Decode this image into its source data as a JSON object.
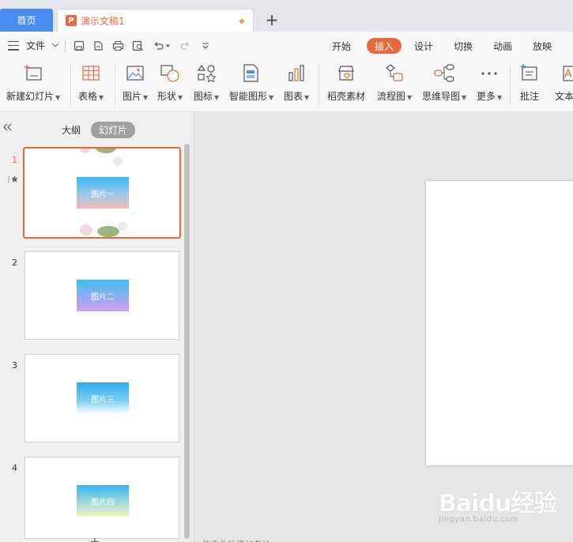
{
  "tabs": {
    "home": "首页",
    "doc_icon": "P",
    "doc_title": "演示文稿1",
    "add": "+"
  },
  "menu": {
    "file": "文件",
    "tabs": [
      "开始",
      "插入",
      "设计",
      "切换",
      "动画",
      "放映"
    ],
    "active_tab": "插入"
  },
  "ribbon": [
    {
      "label": "新建幻灯片",
      "caret": true,
      "icon": "new-slide-icon"
    },
    {
      "label": "表格",
      "caret": true,
      "icon": "table-icon"
    },
    {
      "label": "图片",
      "caret": true,
      "icon": "picture-icon"
    },
    {
      "label": "形状",
      "caret": true,
      "icon": "shapes-icon"
    },
    {
      "label": "图标",
      "caret": true,
      "icon": "icons-icon"
    },
    {
      "label": "智能图形",
      "caret": true,
      "icon": "smartart-icon"
    },
    {
      "label": "图表",
      "caret": true,
      "icon": "chart-icon"
    },
    {
      "label": "稻壳素材",
      "caret": false,
      "icon": "docer-material-icon"
    },
    {
      "label": "流程图",
      "caret": true,
      "icon": "flowchart-icon"
    },
    {
      "label": "思维导图",
      "caret": true,
      "icon": "mindmap-icon"
    },
    {
      "label": "更多",
      "caret": true,
      "icon": "more-icon"
    },
    {
      "label": "批注",
      "caret": false,
      "icon": "comment-icon"
    },
    {
      "label": "文本",
      "caret": false,
      "icon": "textbox-icon"
    }
  ],
  "panel": {
    "collapse": "«",
    "outline": "大纲",
    "slides": "幻灯片",
    "add": "+"
  },
  "slides": [
    {
      "num": "1",
      "text": "图片一"
    },
    {
      "num": "2",
      "text": "图片二"
    },
    {
      "num": "3",
      "text": "图片三"
    },
    {
      "num": "4",
      "text": "图片四"
    }
  ],
  "notes_placeholder": "单击此处添加备注",
  "watermark": {
    "logo": "Baidu经验",
    "url": "jingyan.baidu.com"
  },
  "colors": {
    "accent": "#e8693d",
    "home_tab": "#4a8df0"
  }
}
